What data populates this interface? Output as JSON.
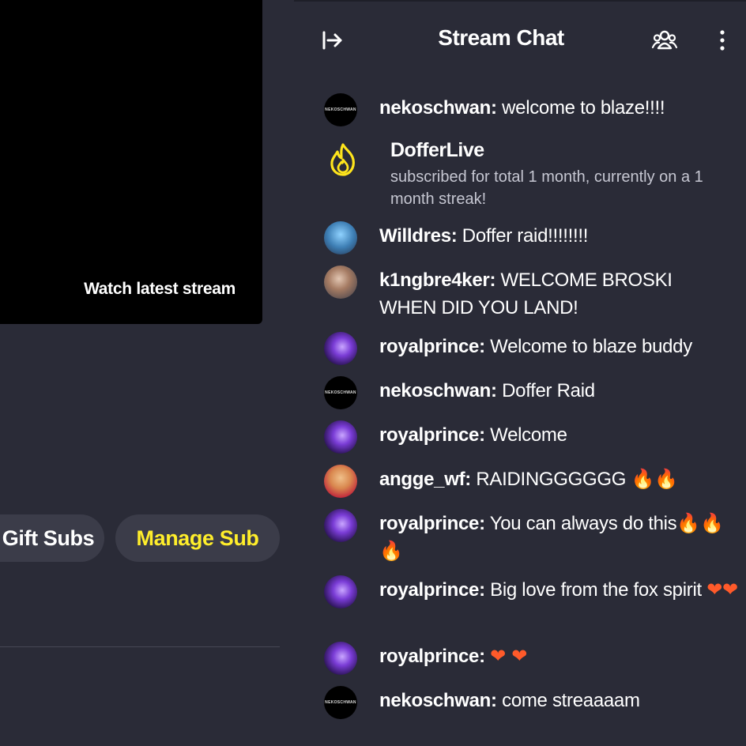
{
  "video": {
    "watch_latest_label": "Watch latest stream"
  },
  "actions": {
    "gift_subs_label": "Gift Subs",
    "manage_sub_label": "Manage Sub"
  },
  "chat": {
    "title": "Stream Chat",
    "icons": {
      "collapse": "collapse-chat-icon",
      "users": "chat-users-icon",
      "more": "more-options-icon"
    },
    "subscription": {
      "user": "DofferLive",
      "text": "subscribed for total 1 month, currently on a 1 month streak!",
      "icon": "flame-icon"
    },
    "messages": [
      {
        "user": "nekoschwan:",
        "text": " welcome to blaze!!!!",
        "avatar_label": "NEKOSCHWAN"
      },
      {
        "user": "Willdres:",
        "text": " Doffer raid!!!!!!!!"
      },
      {
        "user": "k1ngbre4ker:",
        "text": " WELCOME BROSKI WHEN DID YOU LAND!"
      },
      {
        "user": "royalprince:",
        "text": " Welcome to blaze buddy"
      },
      {
        "user": "nekoschwan:",
        "text": " Doffer Raid",
        "avatar_label": "NEKOSCHWAN"
      },
      {
        "user": "royalprince:",
        "text": " Welcome"
      },
      {
        "user": "angge_wf:",
        "text": " RAIDINGGGGGG ",
        "emoji": "🔥🔥"
      },
      {
        "user": "royalprince:",
        "text": " You can always do this",
        "emoji": "🔥🔥🔥"
      },
      {
        "user": "royalprince:",
        "text": " Big love from the fox spirit ",
        "emoji": "❤❤"
      },
      {
        "user": "royalprince:",
        "text": " ",
        "emoji": "❤ ❤"
      },
      {
        "user": "nekoschwan:",
        "text": " come streaaaam",
        "avatar_label": "NEKOSCHWAN"
      }
    ]
  },
  "colors": {
    "background": "#2a2b37",
    "pill": "#3b3c49",
    "accent_yellow": "#ffee2b"
  }
}
